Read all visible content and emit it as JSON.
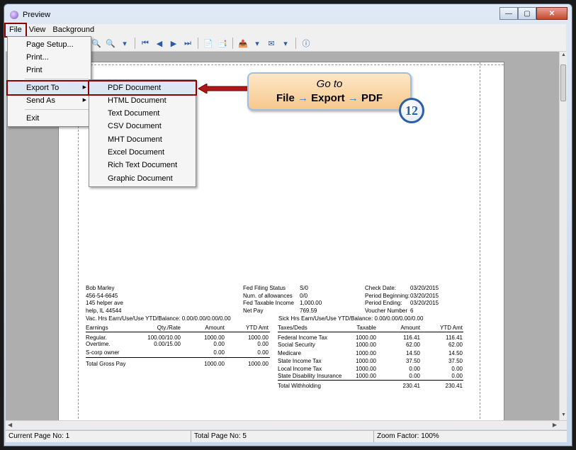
{
  "window": {
    "title": "Preview",
    "min": "—",
    "max": "▢",
    "close": "✕"
  },
  "menubar": [
    "File",
    "View",
    "Background"
  ],
  "file_menu": {
    "items": [
      "Page Setup...",
      "Print...",
      "Print",
      "Export To",
      "Send As",
      "Exit"
    ]
  },
  "export_menu": {
    "items": [
      "PDF Document",
      "HTML Document",
      "Text Document",
      "CSV Document",
      "MHT Document",
      "Excel Document",
      "Rich Text Document",
      "Graphic Document"
    ]
  },
  "callout": {
    "line1": "Go to",
    "file": "File",
    "export": "Export",
    "pdf": "PDF",
    "arrow": "→",
    "step": "12"
  },
  "status": {
    "current": "Current Page No: 1",
    "total": "Total Page No: 5",
    "zoom": "Zoom Factor: 100%"
  },
  "report": {
    "employee": {
      "name": "Bob  Marley",
      "ssn": "456-54-6645",
      "address1": "145 helper ave",
      "address2": "help, IL 44544"
    },
    "filing": {
      "labels": [
        "Fed Filing Status",
        "Num. of allowances",
        "Fed Taxable Income",
        "Net Pay"
      ],
      "values": [
        "S/0",
        "0/0",
        "1,000.00",
        "769.59"
      ]
    },
    "check": {
      "labels": [
        "Check Date:",
        "Period Beginning:",
        "Period Ending:",
        "Voucher Number"
      ],
      "values": [
        "03/20/2015",
        "03/20/2015",
        "03/20/2015",
        "6"
      ]
    },
    "vac": "Vac. Hrs Earn/Use/Use YTD/Balance: 0.00/0.00/0.00/0.00",
    "sick": "Sick Hrs Earn/Use/Use YTD/Balance:  0.00/0.00/0.00/0.00",
    "earnings": {
      "headers": [
        "Earnings",
        "Qty./Rate",
        "Amount",
        "YTD Amt"
      ],
      "rows": [
        [
          "Regular.",
          "100.00/10.00",
          "1000.00",
          "1000.00"
        ],
        [
          "Overtime.",
          "0.00/15.00",
          "0.00",
          "0.00"
        ],
        [
          "S-corp owner",
          "",
          "0.00",
          "0.00"
        ]
      ],
      "total": [
        "Total Gross Pay",
        "",
        "1000.00",
        "1000.00"
      ]
    },
    "taxes": {
      "headers": [
        "Taxes/Deds",
        "Taxable",
        "Amount",
        "YTD Amt"
      ],
      "rows": [
        [
          "Federal Income Tax",
          "1000.00",
          "116.41",
          "116.41"
        ],
        [
          "Social Security",
          "1000.00",
          "62.00",
          "62.00"
        ],
        [
          "Medicare",
          "1000.00",
          "14.50",
          "14.50"
        ],
        [
          "State Income Tax",
          "1000.00",
          "37.50",
          "37.50"
        ],
        [
          "Local Income Tax",
          "1000.00",
          "0.00",
          "0.00"
        ],
        [
          "State Disability Insurance",
          "1000.00",
          "0.00",
          "0.00"
        ]
      ],
      "total": [
        "Total Withholding",
        "",
        "230.41",
        "230.41"
      ]
    }
  },
  "icons": {
    "zoom_in": "🔍",
    "zoom_out": "🔍",
    "first": "⏮",
    "prev": "◀",
    "next": "▶",
    "last": "⏭",
    "page": "📄",
    "pages": "📑",
    "export": "📤",
    "email": "✉",
    "help": "ⓘ",
    "dropdown": "▾"
  },
  "colors": {
    "highlight_outline": "#8b0000",
    "callout_fill": "#fbd9a8",
    "badge": "#2a5ea8"
  }
}
